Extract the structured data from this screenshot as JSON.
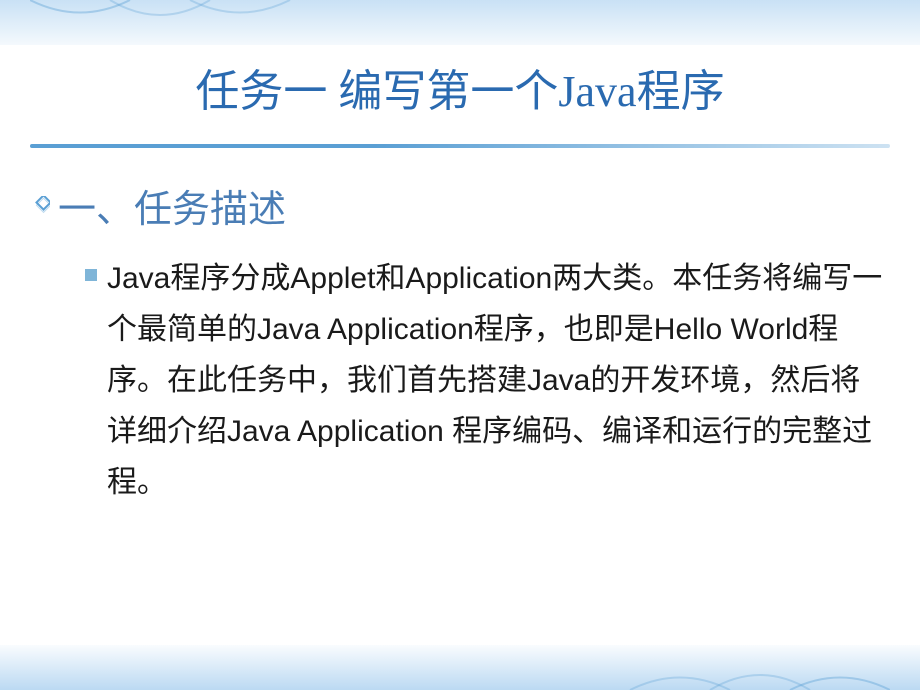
{
  "slide": {
    "title": "任务一  编写第一个Java程序",
    "section_heading": "一、任务描述",
    "body_text": "Java程序分成Applet和Application两大类。本任务将编写一个最简单的Java Application程序，也即是Hello World程序。在此任务中，我们首先搭建Java的开发环境，然后将详细介绍Java Application 程序编码、编译和运行的完整过程。"
  },
  "colors": {
    "title_color": "#2a6ab0",
    "heading_color": "#4a7db5",
    "accent": "#5a9fd4",
    "bullet": "#7fb5d8"
  }
}
